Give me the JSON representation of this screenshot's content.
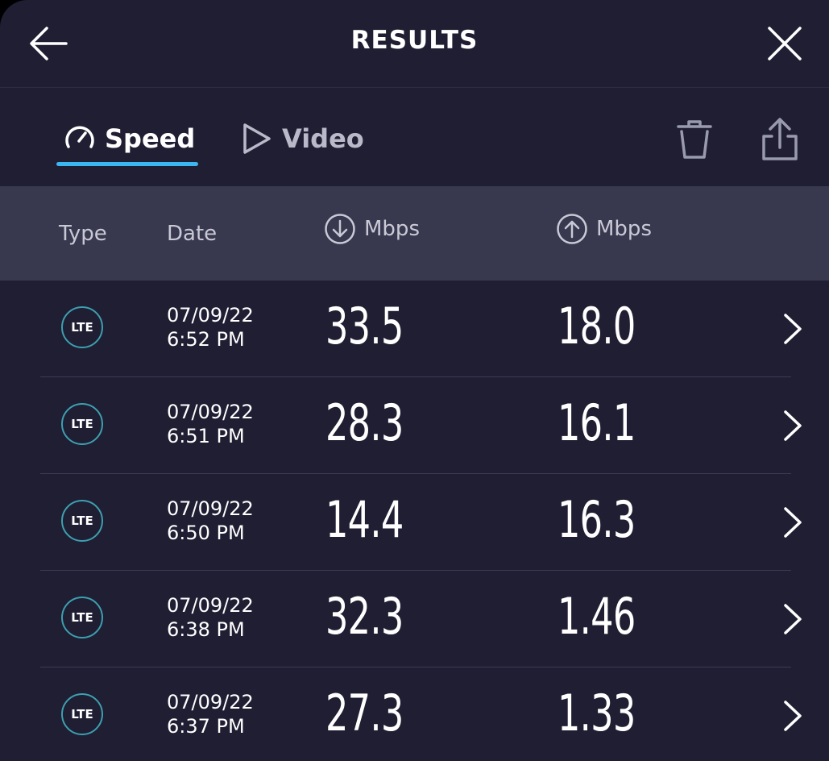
{
  "header": {
    "title": "RESULTS",
    "back_icon": "arrow-left-icon",
    "close_icon": "close-icon"
  },
  "tabs": [
    {
      "label": "Speed",
      "icon": "speedometer-icon",
      "active": true
    },
    {
      "label": "Video",
      "icon": "play-icon",
      "active": false
    }
  ],
  "toolbar": {
    "delete_icon": "trash-icon",
    "share_icon": "share-icon"
  },
  "columns": {
    "type": "Type",
    "date": "Date",
    "download": "Mbps",
    "upload": "Mbps"
  },
  "rows": [
    {
      "type": "LTE",
      "date": "07/09/22",
      "time": "6:52 PM",
      "download": "33.5",
      "upload": "18.0"
    },
    {
      "type": "LTE",
      "date": "07/09/22",
      "time": "6:51 PM",
      "download": "28.3",
      "upload": "16.1"
    },
    {
      "type": "LTE",
      "date": "07/09/22",
      "time": "6:50 PM",
      "download": "14.4",
      "upload": "16.3"
    },
    {
      "type": "LTE",
      "date": "07/09/22",
      "time": "6:38 PM",
      "download": "32.3",
      "upload": "1.46"
    },
    {
      "type": "LTE",
      "date": "07/09/22",
      "time": "6:37 PM",
      "download": "27.3",
      "upload": "1.33"
    }
  ],
  "colors": {
    "background": "#1f1e33",
    "header_band": "#38384f",
    "accent": "#3cb6f0",
    "badge_ring": "#3d9fb0"
  }
}
